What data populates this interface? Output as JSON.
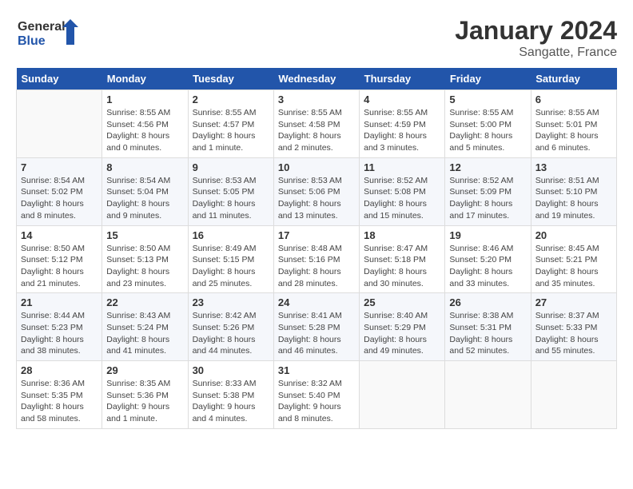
{
  "header": {
    "logo_general": "General",
    "logo_blue": "Blue",
    "month": "January 2024",
    "location": "Sangatte, France"
  },
  "weekdays": [
    "Sunday",
    "Monday",
    "Tuesday",
    "Wednesday",
    "Thursday",
    "Friday",
    "Saturday"
  ],
  "weeks": [
    [
      {
        "day": "",
        "info": ""
      },
      {
        "day": "1",
        "info": "Sunrise: 8:55 AM\nSunset: 4:56 PM\nDaylight: 8 hours\nand 0 minutes."
      },
      {
        "day": "2",
        "info": "Sunrise: 8:55 AM\nSunset: 4:57 PM\nDaylight: 8 hours\nand 1 minute."
      },
      {
        "day": "3",
        "info": "Sunrise: 8:55 AM\nSunset: 4:58 PM\nDaylight: 8 hours\nand 2 minutes."
      },
      {
        "day": "4",
        "info": "Sunrise: 8:55 AM\nSunset: 4:59 PM\nDaylight: 8 hours\nand 3 minutes."
      },
      {
        "day": "5",
        "info": "Sunrise: 8:55 AM\nSunset: 5:00 PM\nDaylight: 8 hours\nand 5 minutes."
      },
      {
        "day": "6",
        "info": "Sunrise: 8:55 AM\nSunset: 5:01 PM\nDaylight: 8 hours\nand 6 minutes."
      }
    ],
    [
      {
        "day": "7",
        "info": "Sunrise: 8:54 AM\nSunset: 5:02 PM\nDaylight: 8 hours\nand 8 minutes."
      },
      {
        "day": "8",
        "info": "Sunrise: 8:54 AM\nSunset: 5:04 PM\nDaylight: 8 hours\nand 9 minutes."
      },
      {
        "day": "9",
        "info": "Sunrise: 8:53 AM\nSunset: 5:05 PM\nDaylight: 8 hours\nand 11 minutes."
      },
      {
        "day": "10",
        "info": "Sunrise: 8:53 AM\nSunset: 5:06 PM\nDaylight: 8 hours\nand 13 minutes."
      },
      {
        "day": "11",
        "info": "Sunrise: 8:52 AM\nSunset: 5:08 PM\nDaylight: 8 hours\nand 15 minutes."
      },
      {
        "day": "12",
        "info": "Sunrise: 8:52 AM\nSunset: 5:09 PM\nDaylight: 8 hours\nand 17 minutes."
      },
      {
        "day": "13",
        "info": "Sunrise: 8:51 AM\nSunset: 5:10 PM\nDaylight: 8 hours\nand 19 minutes."
      }
    ],
    [
      {
        "day": "14",
        "info": "Sunrise: 8:50 AM\nSunset: 5:12 PM\nDaylight: 8 hours\nand 21 minutes."
      },
      {
        "day": "15",
        "info": "Sunrise: 8:50 AM\nSunset: 5:13 PM\nDaylight: 8 hours\nand 23 minutes."
      },
      {
        "day": "16",
        "info": "Sunrise: 8:49 AM\nSunset: 5:15 PM\nDaylight: 8 hours\nand 25 minutes."
      },
      {
        "day": "17",
        "info": "Sunrise: 8:48 AM\nSunset: 5:16 PM\nDaylight: 8 hours\nand 28 minutes."
      },
      {
        "day": "18",
        "info": "Sunrise: 8:47 AM\nSunset: 5:18 PM\nDaylight: 8 hours\nand 30 minutes."
      },
      {
        "day": "19",
        "info": "Sunrise: 8:46 AM\nSunset: 5:20 PM\nDaylight: 8 hours\nand 33 minutes."
      },
      {
        "day": "20",
        "info": "Sunrise: 8:45 AM\nSunset: 5:21 PM\nDaylight: 8 hours\nand 35 minutes."
      }
    ],
    [
      {
        "day": "21",
        "info": "Sunrise: 8:44 AM\nSunset: 5:23 PM\nDaylight: 8 hours\nand 38 minutes."
      },
      {
        "day": "22",
        "info": "Sunrise: 8:43 AM\nSunset: 5:24 PM\nDaylight: 8 hours\nand 41 minutes."
      },
      {
        "day": "23",
        "info": "Sunrise: 8:42 AM\nSunset: 5:26 PM\nDaylight: 8 hours\nand 44 minutes."
      },
      {
        "day": "24",
        "info": "Sunrise: 8:41 AM\nSunset: 5:28 PM\nDaylight: 8 hours\nand 46 minutes."
      },
      {
        "day": "25",
        "info": "Sunrise: 8:40 AM\nSunset: 5:29 PM\nDaylight: 8 hours\nand 49 minutes."
      },
      {
        "day": "26",
        "info": "Sunrise: 8:38 AM\nSunset: 5:31 PM\nDaylight: 8 hours\nand 52 minutes."
      },
      {
        "day": "27",
        "info": "Sunrise: 8:37 AM\nSunset: 5:33 PM\nDaylight: 8 hours\nand 55 minutes."
      }
    ],
    [
      {
        "day": "28",
        "info": "Sunrise: 8:36 AM\nSunset: 5:35 PM\nDaylight: 8 hours\nand 58 minutes."
      },
      {
        "day": "29",
        "info": "Sunrise: 8:35 AM\nSunset: 5:36 PM\nDaylight: 9 hours\nand 1 minute."
      },
      {
        "day": "30",
        "info": "Sunrise: 8:33 AM\nSunset: 5:38 PM\nDaylight: 9 hours\nand 4 minutes."
      },
      {
        "day": "31",
        "info": "Sunrise: 8:32 AM\nSunset: 5:40 PM\nDaylight: 9 hours\nand 8 minutes."
      },
      {
        "day": "",
        "info": ""
      },
      {
        "day": "",
        "info": ""
      },
      {
        "day": "",
        "info": ""
      }
    ]
  ]
}
